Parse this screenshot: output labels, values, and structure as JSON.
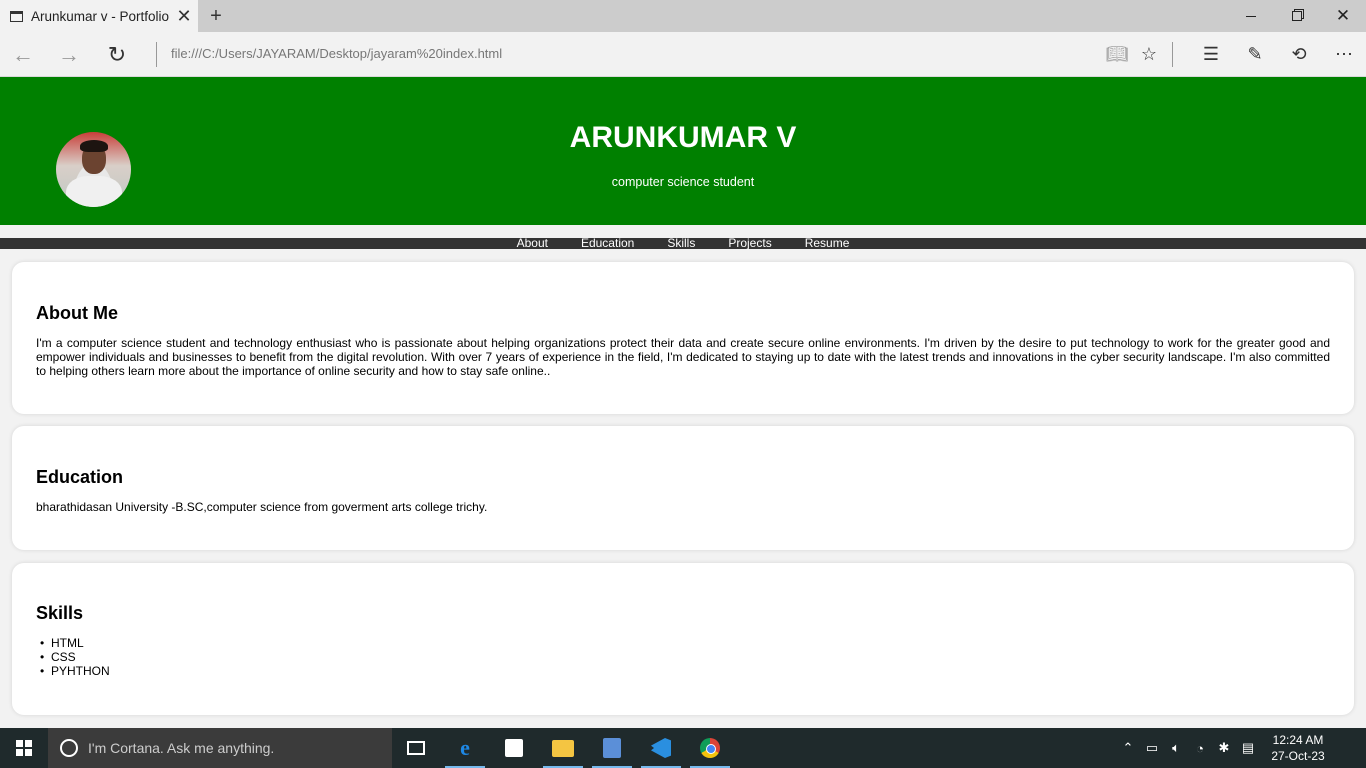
{
  "browser": {
    "tab_title": "Arunkumar v - Portfolio",
    "url": "file:///C:/Users/JAYARAM/Desktop/jayaram%20index.html"
  },
  "header": {
    "name": "ARUNKUMAR V",
    "subtitle": "computer science student"
  },
  "nav": {
    "items": [
      "About",
      "Education",
      "Skills",
      "Projects",
      "Resume"
    ]
  },
  "about": {
    "title": "About Me",
    "text": "I'm a computer science student and technology enthusiast who is passionate about helping organizations protect their data and create secure online environments. I'm driven by the desire to put technology to work for the greater good and empower individuals and businesses to benefit from the digital revolution. With over 7 years of experience in the field, I'm dedicated to staying up to date with the latest trends and innovations in the cyber security landscape. I'm also committed to helping others learn more about the importance of online security and how to stay safe online.."
  },
  "education": {
    "title": "Education",
    "text": "bharathidasan University -B.SC,computer science from goverment arts college trichy."
  },
  "skills": {
    "title": "Skills",
    "items": [
      "HTML",
      "CSS",
      "PYHTHON"
    ]
  },
  "taskbar": {
    "cortana_placeholder": "I'm Cortana. Ask me anything.",
    "time": "12:24 AM",
    "date": "27-Oct-23"
  },
  "colors": {
    "hero_bg": "#008000",
    "navbar_bg": "#333333"
  }
}
